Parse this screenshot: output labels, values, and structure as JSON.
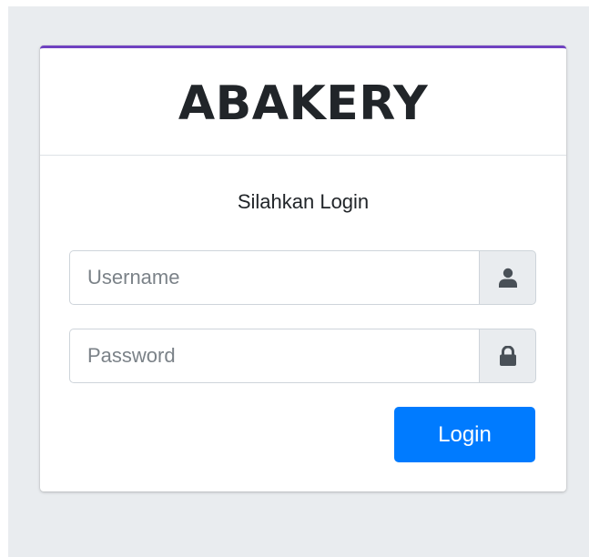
{
  "brand": {
    "title": "ABAKERY"
  },
  "form": {
    "message": "Silahkan Login",
    "username": {
      "placeholder": "Username",
      "value": "",
      "icon": "user-icon"
    },
    "password": {
      "placeholder": "Password",
      "value": "",
      "icon": "lock-icon"
    },
    "submit_label": "Login"
  },
  "colors": {
    "accent_top": "#6f42c1",
    "primary": "#007bff",
    "page_bg": "#e9ecef"
  }
}
